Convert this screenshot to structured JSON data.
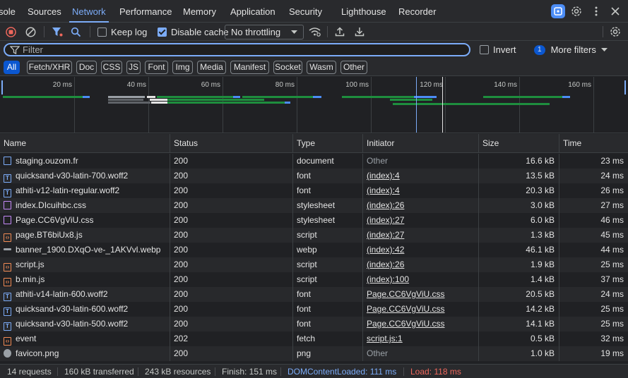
{
  "tabs": [
    {
      "label": "sole",
      "active": false
    },
    {
      "label": "Sources",
      "active": false
    },
    {
      "label": "Network",
      "active": true
    },
    {
      "label": "Performance",
      "active": false
    },
    {
      "label": "Memory",
      "active": false
    },
    {
      "label": "Application",
      "active": false
    },
    {
      "label": "Security",
      "active": false
    },
    {
      "label": "Lighthouse",
      "active": false
    },
    {
      "label": "Recorder",
      "active": false
    }
  ],
  "toolbar": {
    "preserve_log_label": "Keep log",
    "preserve_log_checked": false,
    "disable_cache_label": "Disable cache",
    "disable_cache_checked": true,
    "throttling_value": "No throttling"
  },
  "filter": {
    "placeholder": "Filter",
    "invert_label": "Invert",
    "more_filters_count": "1",
    "more_filters_label": "More filters"
  },
  "type_filters": [
    "All",
    "Fetch/XHR",
    "Doc",
    "CSS",
    "JS",
    "Font",
    "Img",
    "Media",
    "Manifest",
    "Socket",
    "Wasm",
    "Other"
  ],
  "overview_ticks": [
    "20 ms",
    "40 ms",
    "60 ms",
    "80 ms",
    "100 ms",
    "120 ms",
    "140 ms",
    "160 ms"
  ],
  "columns": {
    "name": "Name",
    "status": "Status",
    "type": "Type",
    "initiator": "Initiator",
    "size": "Size",
    "time": "Time"
  },
  "requests": [
    {
      "name": "staging.ouzom.fr",
      "status": "200",
      "type": "document",
      "initiator": "Other",
      "size": "16.6 kB",
      "time": "23 ms",
      "icon": "document"
    },
    {
      "name": "quicksand-v30-latin-700.woff2",
      "status": "200",
      "type": "font",
      "initiator": "(index):4",
      "size": "13.5 kB",
      "time": "24 ms",
      "icon": "font"
    },
    {
      "name": "athiti-v12-latin-regular.woff2",
      "status": "200",
      "type": "font",
      "initiator": "(index):4",
      "size": "20.3 kB",
      "time": "26 ms",
      "icon": "font"
    },
    {
      "name": "index.DIcuihbc.css",
      "status": "200",
      "type": "stylesheet",
      "initiator": "(index):26",
      "size": "3.0 kB",
      "time": "27 ms",
      "icon": "stylesheet"
    },
    {
      "name": "Page.CC6VgViU.css",
      "status": "200",
      "type": "stylesheet",
      "initiator": "(index):27",
      "size": "6.0 kB",
      "time": "46 ms",
      "icon": "stylesheet"
    },
    {
      "name": "page.BT6biUx8.js",
      "status": "200",
      "type": "script",
      "initiator": "(index):27",
      "size": "1.3 kB",
      "time": "45 ms",
      "icon": "script"
    },
    {
      "name": "banner_1900.DXqO-ve-_1AKVvl.webp",
      "status": "200",
      "type": "webp",
      "initiator": "(index):42",
      "size": "46.1 kB",
      "time": "44 ms",
      "icon": "image"
    },
    {
      "name": "script.js",
      "status": "200",
      "type": "script",
      "initiator": "(index):26",
      "size": "1.9 kB",
      "time": "25 ms",
      "icon": "script"
    },
    {
      "name": "b.min.js",
      "status": "200",
      "type": "script",
      "initiator": "(index):100",
      "size": "1.4 kB",
      "time": "37 ms",
      "icon": "script"
    },
    {
      "name": "athiti-v14-latin-600.woff2",
      "status": "200",
      "type": "font",
      "initiator": "Page.CC6VgViU.css",
      "size": "20.5 kB",
      "time": "24 ms",
      "icon": "font"
    },
    {
      "name": "quicksand-v30-latin-600.woff2",
      "status": "200",
      "type": "font",
      "initiator": "Page.CC6VgViU.css",
      "size": "14.2 kB",
      "time": "25 ms",
      "icon": "font"
    },
    {
      "name": "quicksand-v30-latin-500.woff2",
      "status": "200",
      "type": "font",
      "initiator": "Page.CC6VgViU.css",
      "size": "14.1 kB",
      "time": "25 ms",
      "icon": "font"
    },
    {
      "name": "event",
      "status": "202",
      "type": "fetch",
      "initiator": "script.js:1",
      "size": "0.5 kB",
      "time": "32 ms",
      "icon": "fetch"
    },
    {
      "name": "favicon.png",
      "status": "200",
      "type": "png",
      "initiator": "Other",
      "size": "1.0 kB",
      "time": "19 ms",
      "icon": "image-round"
    }
  ],
  "statusbar": {
    "requests": "14 requests",
    "transferred": "160 kB transferred",
    "resources": "243 kB resources",
    "finish": "Finish: 151 ms",
    "dom_content_loaded": "DOMContentLoaded: 111 ms",
    "load": "Load: 118 ms"
  },
  "colors": {
    "accent": "#7cacf8",
    "dcl_line": "#7cacf8",
    "load_line": "#ee675c",
    "bar_green": "#1e8e3e",
    "bar_blue": "#4c8df6"
  }
}
